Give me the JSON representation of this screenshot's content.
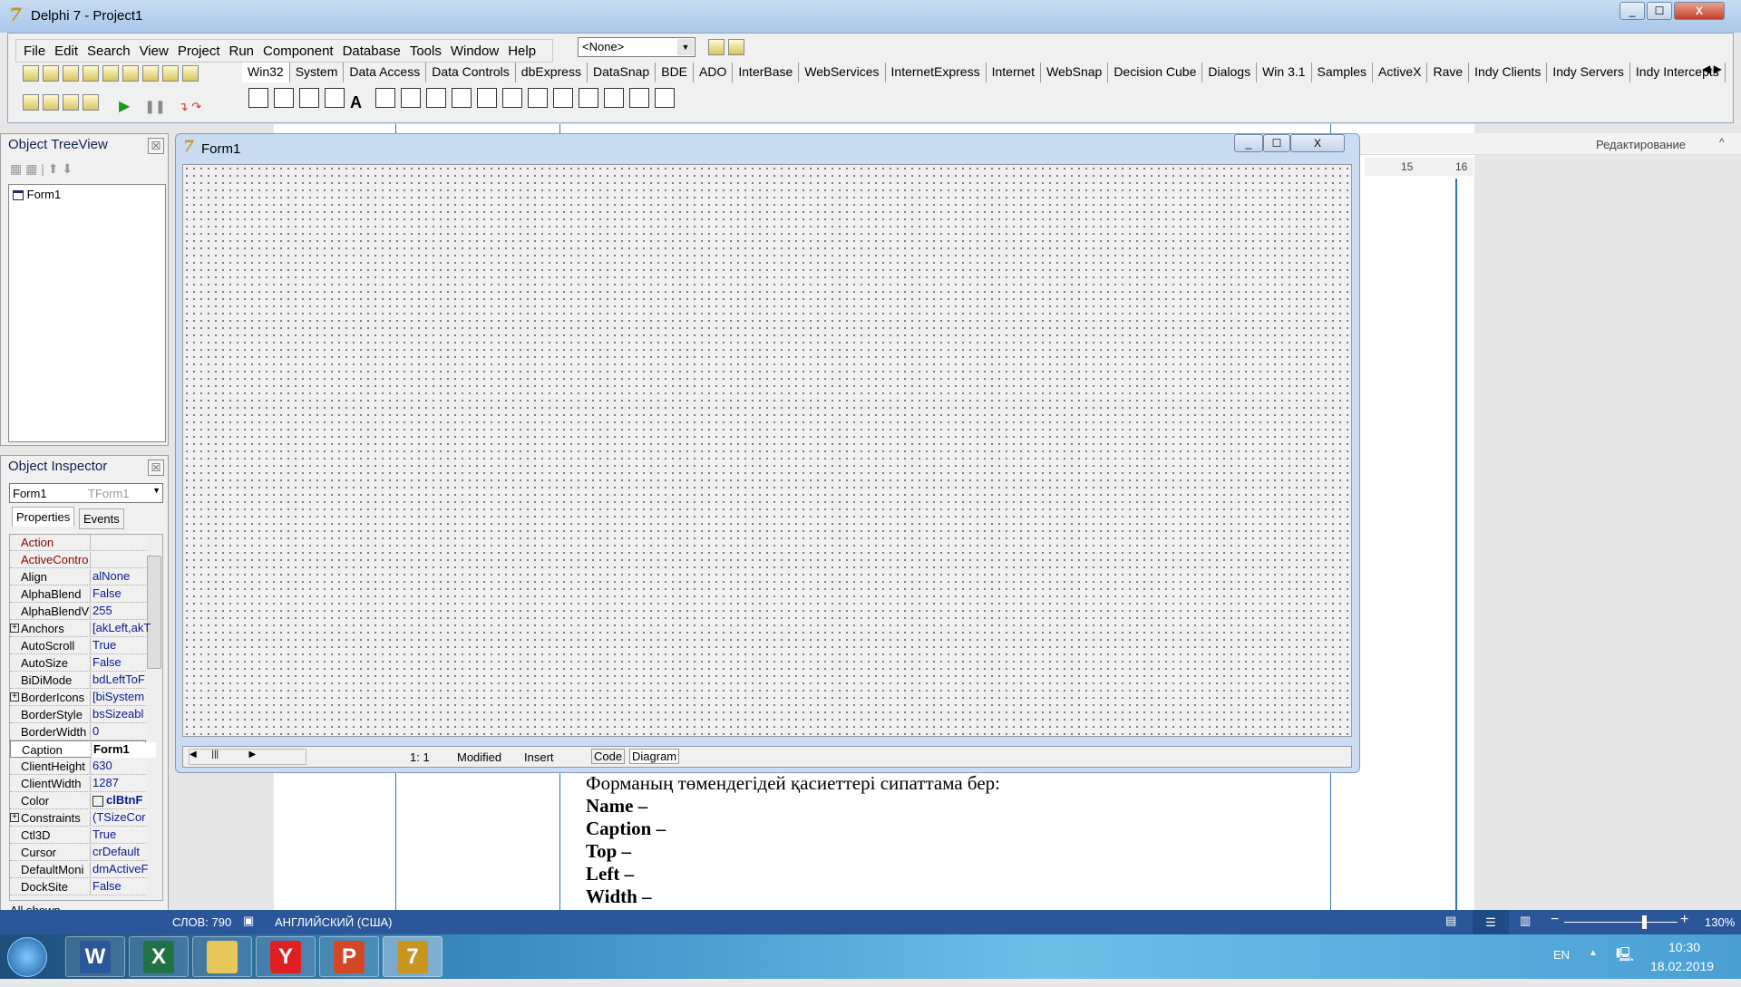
{
  "window": {
    "title": "Delphi 7 - Project1",
    "min": "—",
    "max": "☐",
    "close": "X"
  },
  "menu": [
    "File",
    "Edit",
    "Search",
    "View",
    "Project",
    "Run",
    "Component",
    "Database",
    "Tools",
    "Window",
    "Help"
  ],
  "toolbar_combo": "<None>",
  "palette_tabs": [
    "Win32",
    "System",
    "Data Access",
    "Data Controls",
    "dbExpress",
    "DataSnap",
    "BDE",
    "ADO",
    "InterBase",
    "WebServices",
    "InternetExpress",
    "Internet",
    "WebSnap",
    "Decision Cube",
    "Dialogs",
    "Win 3.1",
    "Samples",
    "ActiveX",
    "Rave",
    "Indy Clients",
    "Indy Servers",
    "Indy Intercepts"
  ],
  "treeview": {
    "title": "Object TreeView",
    "items": [
      "Form1"
    ]
  },
  "inspector": {
    "title": "Object Inspector",
    "object": "Form1",
    "type": "TForm1",
    "tabs": [
      "Properties",
      "Events"
    ],
    "footer": "All shown",
    "properties": [
      {
        "name": "Action",
        "value": "",
        "ref": true
      },
      {
        "name": "ActiveContro",
        "value": "",
        "ref": true
      },
      {
        "name": "Align",
        "value": "alNone"
      },
      {
        "name": "AlphaBlend",
        "value": "False"
      },
      {
        "name": "AlphaBlendV",
        "value": "255"
      },
      {
        "name": "Anchors",
        "value": "[akLeft,akT",
        "expand": true
      },
      {
        "name": "AutoScroll",
        "value": "True"
      },
      {
        "name": "AutoSize",
        "value": "False"
      },
      {
        "name": "BiDiMode",
        "value": "bdLeftToF"
      },
      {
        "name": "BorderIcons",
        "value": "[biSystem",
        "expand": true
      },
      {
        "name": "BorderStyle",
        "value": "bsSizeabl"
      },
      {
        "name": "BorderWidth",
        "value": "0"
      },
      {
        "name": "Caption",
        "value": "Form1",
        "selected": true
      },
      {
        "name": "ClientHeight",
        "value": "630"
      },
      {
        "name": "ClientWidth",
        "value": "1287"
      },
      {
        "name": "Color",
        "value": "clBtnF",
        "bold": true
      },
      {
        "name": "Constraints",
        "value": "(TSizeCor",
        "expand": true
      },
      {
        "name": "Ctl3D",
        "value": "True"
      },
      {
        "name": "Cursor",
        "value": "crDefault"
      },
      {
        "name": "DefaultMoni",
        "value": "dmActiveF"
      },
      {
        "name": "DockSite",
        "value": "False"
      }
    ]
  },
  "form": {
    "title": "Form1",
    "status": {
      "pos": "1:  1",
      "modified": "Modified",
      "mode": "Insert",
      "tabs": [
        "Code",
        "Diagram"
      ]
    }
  },
  "word": {
    "ribbon_group": "Редактирование",
    "ruler": [
      "15",
      "16"
    ],
    "lines": [
      {
        "text": "Форманың төмендегідей қасиеттері сипаттама бер:",
        "bold": false
      },
      {
        "text": "Name –",
        "bold": true
      },
      {
        "text": "Caption –",
        "bold": true
      },
      {
        "text": "Top –",
        "bold": true
      },
      {
        "text": "Left –",
        "bold": true
      },
      {
        "text": "Width –",
        "bold": true
      }
    ],
    "status": {
      "words": "СЛОВ: 790",
      "language": "АНГЛИЙСКИЙ (США)",
      "zoom": "130%",
      "zoom_percent": 130
    }
  },
  "taskbar": {
    "apps": [
      {
        "name": "word",
        "label": "W",
        "color": "#2b579a"
      },
      {
        "name": "excel",
        "label": "X",
        "color": "#217346"
      },
      {
        "name": "explorer",
        "label": "",
        "color": "#e8c65a"
      },
      {
        "name": "yandex",
        "label": "Y",
        "color": "#e02020"
      },
      {
        "name": "powerpoint",
        "label": "P",
        "color": "#d24726"
      },
      {
        "name": "delphi",
        "label": "7",
        "color": "#c8961e"
      }
    ],
    "lang": "EN",
    "time": "10:30",
    "date": "18.02.2019"
  },
  "colors": {
    "word_blue": "#2b579a",
    "property_ref": "#8b0000",
    "property_value": "#0b1b8c"
  }
}
